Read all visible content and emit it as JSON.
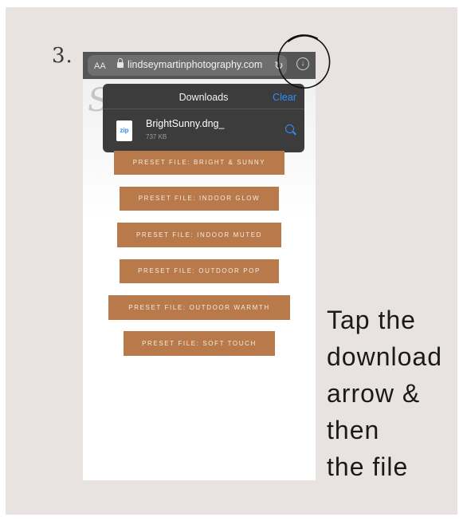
{
  "step_number": "3.",
  "browser": {
    "aa_label": "AA",
    "url": "lindseymartinphotography.com"
  },
  "downloads_popover": {
    "title": "Downloads",
    "clear_label": "Clear",
    "file": {
      "type_badge": "zip",
      "name": "BrightSunny.dng_",
      "size": "737 KB"
    }
  },
  "presets": [
    "PRESET FILE: BRIGHT & SUNNY",
    "PRESET FILE: INDOOR GLOW",
    "PRESET FILE: INDOOR MUTED",
    "PRESET FILE: OUTDOOR POP",
    "PRESET FILE: OUTDOOR WARMTH",
    "PRESET FILE: SOFT TOUCH"
  ],
  "caption_lines": [
    "Tap the",
    "download",
    "arrow &",
    "then",
    "the file"
  ],
  "colors": {
    "card_bg": "#e8e3e0",
    "preset_bg": "#b87a4b",
    "popover_bg": "#3c3c3c",
    "accent_blue": "#2f8cff"
  },
  "icons": [
    "lock-icon",
    "reload-icon",
    "download-arrow-icon",
    "zip-file-icon",
    "magnifier-icon"
  ]
}
